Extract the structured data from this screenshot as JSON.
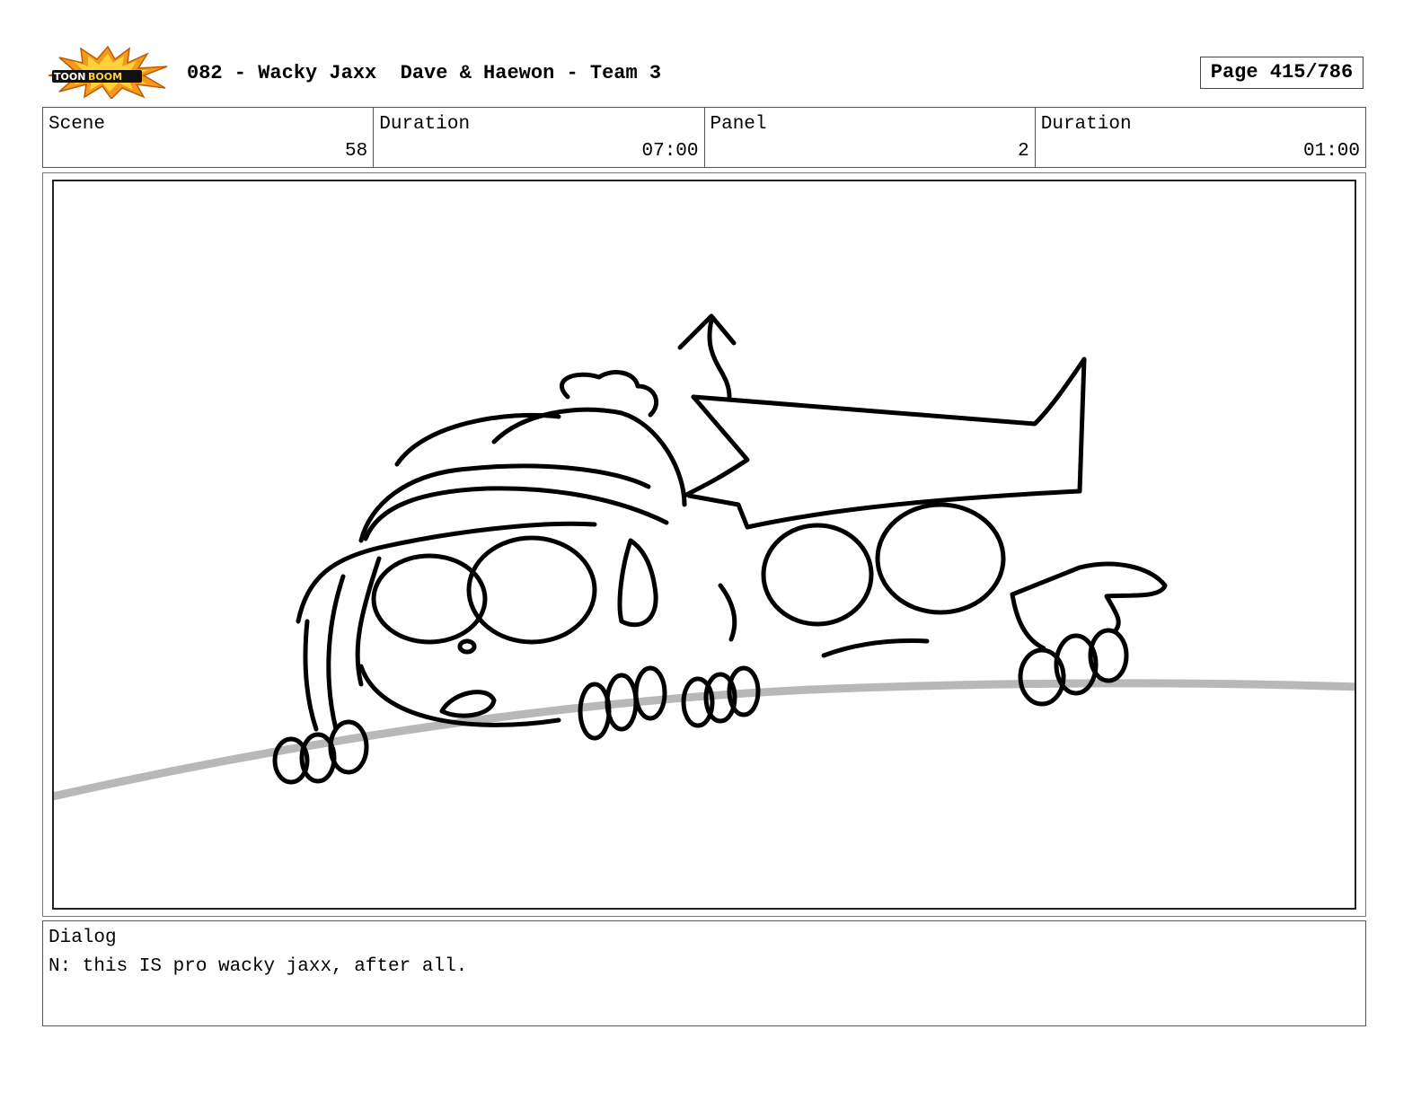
{
  "header": {
    "logo_text": "TOONBOOM",
    "title": "082 - Wacky Jaxx  Dave & Haewon - Team 3",
    "page": "Page 415/786"
  },
  "info": {
    "scene_label": "Scene",
    "scene_value": "58",
    "scene_duration_label": "Duration",
    "scene_duration_value": "07:00",
    "panel_label": "Panel",
    "panel_value": "2",
    "panel_duration_label": "Duration",
    "panel_duration_value": "01:00"
  },
  "dialog": {
    "label": "Dialog",
    "text": "N: this IS pro wacky jaxx, after all."
  },
  "colors": {
    "logo_orange": "#f39a1e",
    "logo_yellow": "#ffd23a",
    "ground_line": "#b8b8b8",
    "ink": "#000000"
  },
  "icons": {
    "logo": "toonboom-burst-logo"
  }
}
